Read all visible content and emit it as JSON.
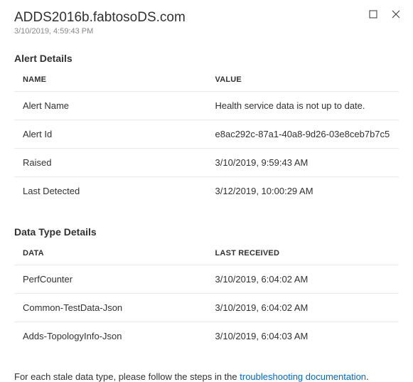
{
  "header": {
    "title": "ADDS2016b.fabtosoDS.com",
    "timestamp": "3/10/2019, 4:59:43 PM"
  },
  "alert_details": {
    "heading": "Alert Details",
    "columns": {
      "name": "NAME",
      "value": "VALUE"
    },
    "rows": [
      {
        "name": "Alert Name",
        "value": "Health service data is not up to date."
      },
      {
        "name": "Alert Id",
        "value": "e8ac292c-87a1-40a8-9d26-03e8ceb7b7c5"
      },
      {
        "name": "Raised",
        "value": "3/10/2019, 9:59:43 AM"
      },
      {
        "name": "Last Detected",
        "value": "3/12/2019, 10:00:29 AM"
      }
    ]
  },
  "data_type_details": {
    "heading": "Data Type Details",
    "columns": {
      "data": "DATA",
      "last_received": "LAST RECEIVED"
    },
    "rows": [
      {
        "data": "PerfCounter",
        "last_received": "3/10/2019, 6:04:02 AM"
      },
      {
        "data": "Common-TestData-Json",
        "last_received": "3/10/2019, 6:04:02 AM"
      },
      {
        "data": "Adds-TopologyInfo-Json",
        "last_received": "3/10/2019, 6:04:03 AM"
      }
    ]
  },
  "footer": {
    "text": "For each stale data type, please follow the steps in the ",
    "link_text": "troubleshooting documentation",
    "suffix": "."
  }
}
